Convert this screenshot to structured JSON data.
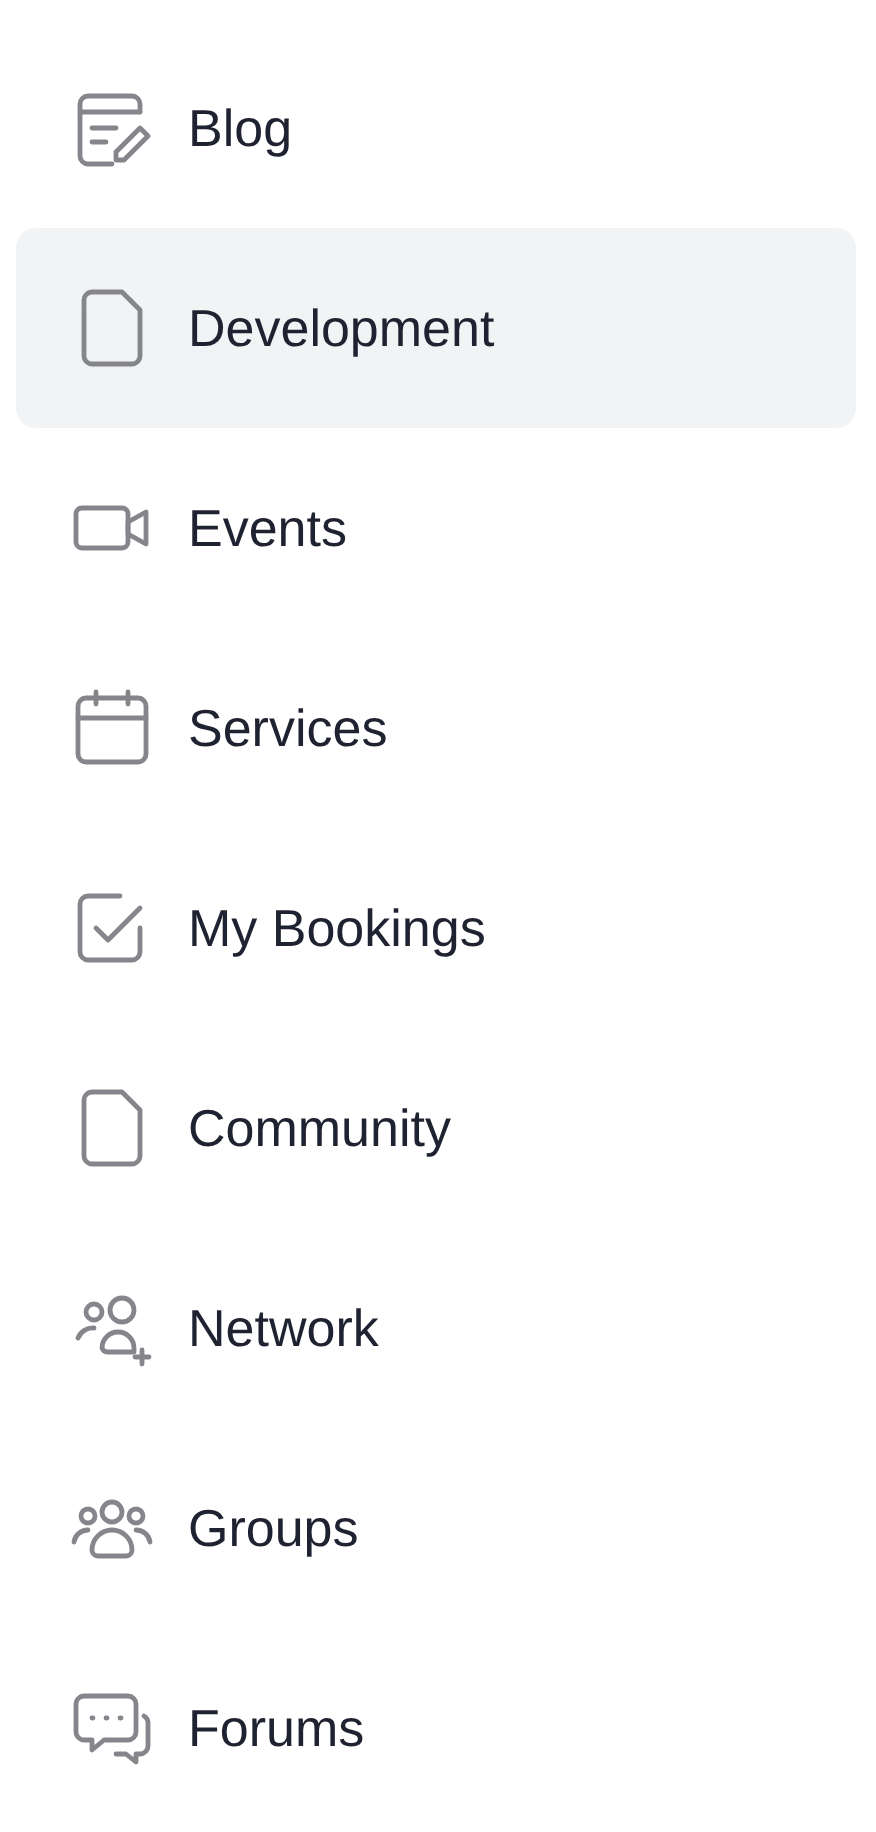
{
  "menu": {
    "items": [
      {
        "label": "Blog",
        "kind": "blog",
        "selected": false
      },
      {
        "label": "Development",
        "kind": "page",
        "selected": true
      },
      {
        "label": "Events",
        "kind": "video",
        "selected": false
      },
      {
        "label": "Services",
        "kind": "calendar",
        "selected": false
      },
      {
        "label": "My Bookings",
        "kind": "check",
        "selected": false
      },
      {
        "label": "Community",
        "kind": "page",
        "selected": false
      },
      {
        "label": "Network",
        "kind": "add-people",
        "selected": false
      },
      {
        "label": "Groups",
        "kind": "people",
        "selected": false
      },
      {
        "label": "Forums",
        "kind": "chat",
        "selected": false
      }
    ]
  }
}
